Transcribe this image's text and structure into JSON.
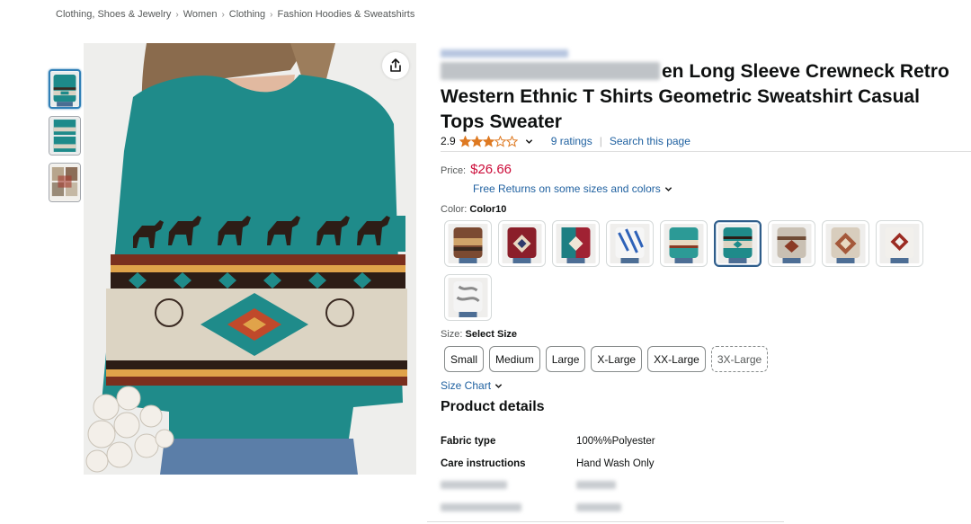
{
  "breadcrumb": [
    "Clothing, Shoes & Jewelry",
    "Women",
    "Clothing",
    "Fashion Hoodies & Sweatshirts"
  ],
  "product": {
    "title_visible": "en Long Sleeve Crewneck Retro Western Ethnic T Shirts Geometric Sweatshirt Casual Tops Sweater",
    "rating_value": "2.9",
    "rating_stars": 2.9,
    "ratings_count": "9 ratings",
    "search_page": "Search this page",
    "price_label": "Price:",
    "price": "$26.66",
    "returns_text": "Free Returns on some sizes and colors",
    "color_label": "Color:",
    "color_selected": "Color10",
    "size_label": "Size:",
    "size_selected": "Select Size",
    "sizes": [
      "Small",
      "Medium",
      "Large",
      "X-Large",
      "XX-Large",
      "3X-Large"
    ],
    "size_chart": "Size Chart",
    "details_heading": "Product details",
    "details": [
      {
        "key": "Fabric type",
        "value": "100%%Polyester"
      },
      {
        "key": "Care instructions",
        "value": "Hand Wash Only"
      }
    ]
  },
  "icons": {
    "share": "share-icon",
    "chevron": "chevron-down-icon",
    "star": "star-icon"
  },
  "colors": {
    "link": "#2162a1",
    "price": "#cc0c39",
    "star": "#de7921",
    "teal": "#1d8a8a",
    "selected_border": "#2f5d8a"
  }
}
